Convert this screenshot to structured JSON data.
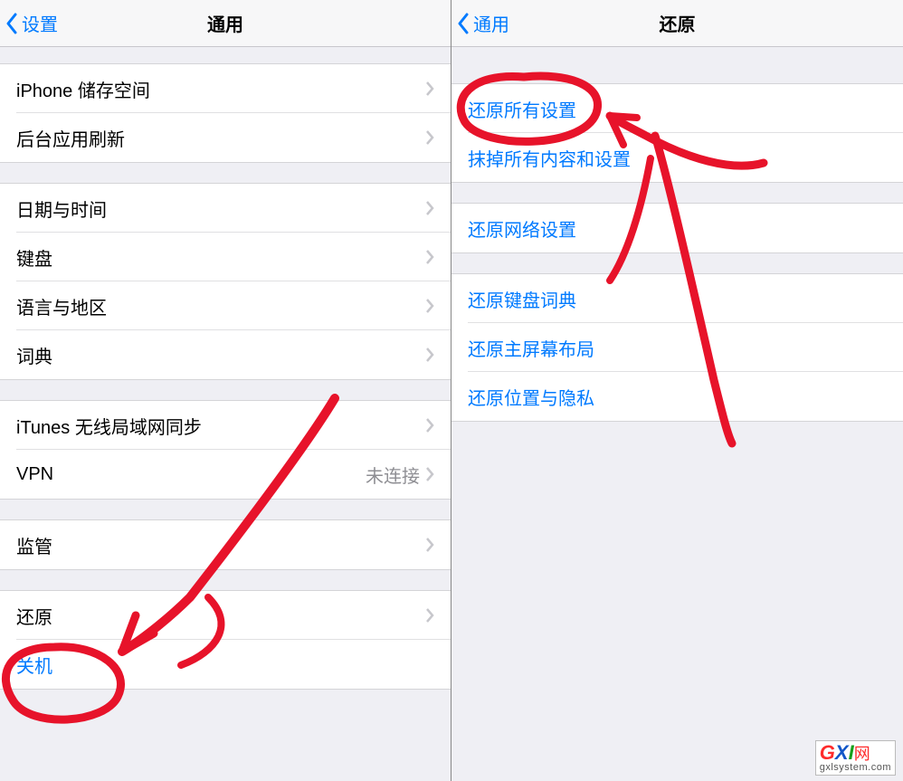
{
  "left": {
    "nav": {
      "back": "设置",
      "title": "通用"
    },
    "groups": [
      [
        {
          "label": "iPhone 储存空间",
          "chevron": true
        },
        {
          "label": "后台应用刷新",
          "chevron": true
        }
      ],
      [
        {
          "label": "日期与时间",
          "chevron": true
        },
        {
          "label": "键盘",
          "chevron": true
        },
        {
          "label": "语言与地区",
          "chevron": true
        },
        {
          "label": "词典",
          "chevron": true
        }
      ],
      [
        {
          "label": "iTunes 无线局域网同步",
          "chevron": true
        },
        {
          "label": "VPN",
          "detail": "未连接",
          "chevron": true
        }
      ],
      [
        {
          "label": "监管",
          "chevron": true
        }
      ],
      [
        {
          "label": "还原",
          "chevron": true
        },
        {
          "label": "关机",
          "blue": true
        }
      ]
    ]
  },
  "right": {
    "nav": {
      "back": "通用",
      "title": "还原"
    },
    "groups": [
      [
        {
          "label": "还原所有设置",
          "blue": true
        },
        {
          "label": "抹掉所有内容和设置",
          "blue": true
        }
      ],
      [
        {
          "label": "还原网络设置",
          "blue": true
        }
      ],
      [
        {
          "label": "还原键盘词典",
          "blue": true
        },
        {
          "label": "还原主屏幕布局",
          "blue": true
        },
        {
          "label": "还原位置与隐私",
          "blue": true
        }
      ]
    ]
  },
  "watermark": {
    "brand_g": "G",
    "brand_x": "X",
    "brand_i": "I",
    "brand_cn": "网",
    "sub": "gxlsystem.com"
  }
}
